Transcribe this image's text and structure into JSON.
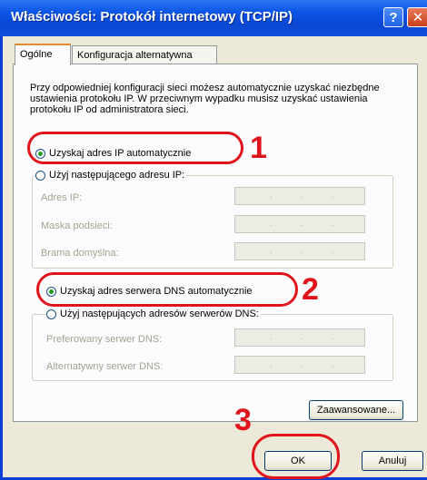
{
  "window": {
    "title": "Właściwości: Protokół internetowy (TCP/IP)",
    "help_glyph": "?",
    "close_glyph": "✕"
  },
  "tabs": [
    {
      "label": "Ogólne"
    },
    {
      "label": "Konfiguracja alternatywna"
    }
  ],
  "description": "Przy odpowiedniej konfiguracji sieci możesz automatycznie uzyskać niezbędne ustawienia protokołu IP. W przeciwnym wypadku musisz uzyskać ustawienia protokołu IP od administratora sieci.",
  "ip": {
    "auto_label": "Uzyskaj adres IP automatycznie",
    "manual_label": "Użyj następującego adresu IP:",
    "auto_selected": true,
    "fields": [
      {
        "label": "Adres IP:"
      },
      {
        "label": "Maska podsieci:"
      },
      {
        "label": "Brama domyślna:"
      }
    ]
  },
  "dns": {
    "auto_label": "Uzyskaj adres serwera DNS automatycznie",
    "manual_label": "Użyj następujących adresów serwerów DNS:",
    "auto_selected": true,
    "fields": [
      {
        "label": "Preferowany serwer DNS:"
      },
      {
        "label": "Alternatywny serwer DNS:"
      }
    ]
  },
  "buttons": {
    "advanced": "Zaawansowane...",
    "ok": "OK",
    "cancel": "Anuluj"
  },
  "steps": [
    "1",
    "2",
    "3"
  ],
  "colors": {
    "title_bar": "#0a47d2",
    "highlight_ring": "#e0151c",
    "radio_check": "#21a121"
  }
}
